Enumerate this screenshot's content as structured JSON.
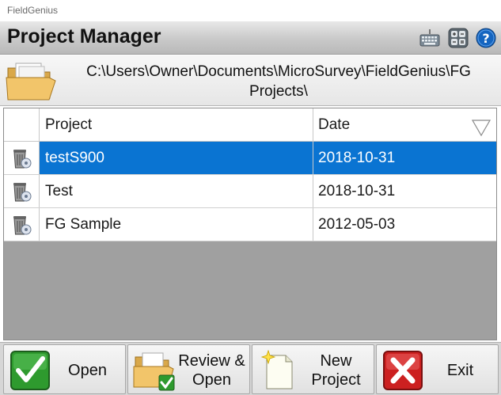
{
  "window": {
    "title": "FieldGenius"
  },
  "header": {
    "title": "Project Manager",
    "icons": [
      "keyboard-icon",
      "calculator-icon",
      "help-icon"
    ]
  },
  "path": {
    "text": "C:\\Users\\Owner\\Documents\\MicroSurvey\\FieldGenius\\FG Projects\\"
  },
  "table": {
    "columns": [
      "Project",
      "Date"
    ],
    "rows": [
      {
        "project": "testS900",
        "date": "2018-10-31",
        "selected": true
      },
      {
        "project": "Test",
        "date": "2018-10-31",
        "selected": false
      },
      {
        "project": "FG Sample",
        "date": "2012-05-03",
        "selected": false
      }
    ]
  },
  "footer": {
    "open": "Open",
    "review_open": "Review & Open",
    "new_project": "New Project",
    "exit": "Exit"
  },
  "colors": {
    "selection": "#0a74d2",
    "open_green": "#2e9a2e",
    "exit_red": "#cc2020",
    "help_blue": "#1565c0"
  }
}
